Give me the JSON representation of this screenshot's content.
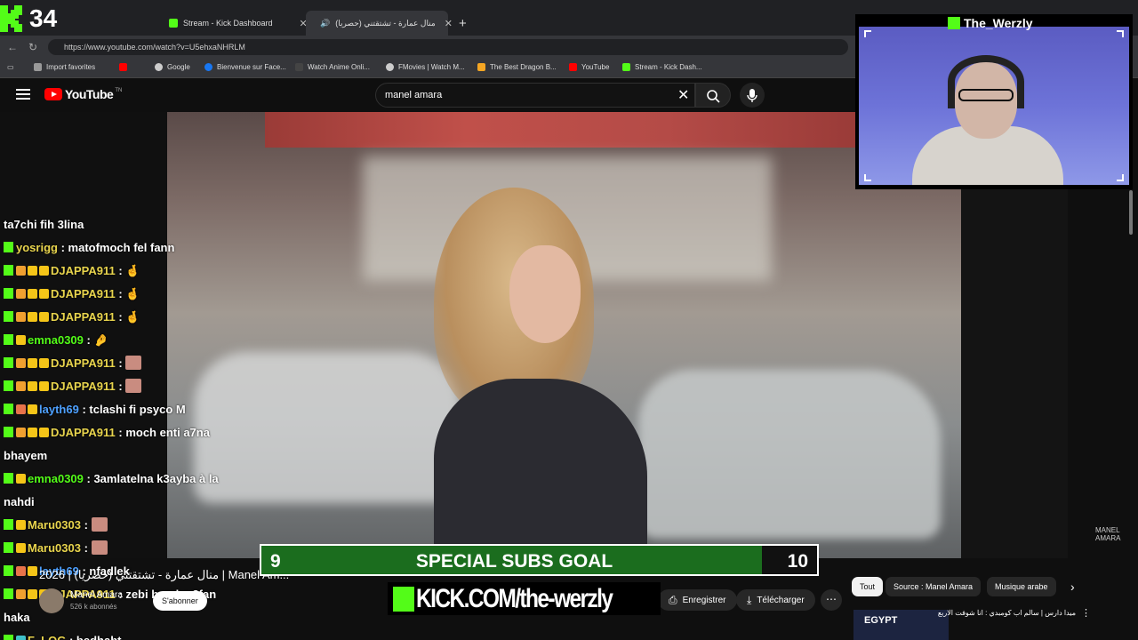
{
  "overlay": {
    "viewer_count": "34",
    "goal": {
      "current": "9",
      "title": "SPECIAL SUBS GOAL",
      "target": "10",
      "progress": 0.9
    },
    "kick_link": "KICK.COM/the-werzly",
    "streamer_name": "The_Werzly"
  },
  "browser": {
    "tabs": [
      {
        "label": "Stream - Kick Dashboard",
        "color": "#53fc18"
      },
      {
        "label": "منال عمارة - تشتقتني (حصريا)",
        "color": "#ff0000"
      }
    ],
    "url": "https://www.youtube.com/watch?v=U5ehxaNHRLM",
    "bookmarks": [
      {
        "label": "Import favorites",
        "color": "#999999"
      },
      {
        "label": "",
        "color": "#ff0000"
      },
      {
        "label": "Google",
        "color": "#cccccc"
      },
      {
        "label": "Bienvenue sur Face...",
        "color": "#1877f2"
      },
      {
        "label": "Watch Anime Onli...",
        "color": "#444444"
      },
      {
        "label": "FMovies | Watch M...",
        "color": "#cccccc"
      },
      {
        "label": "The Best Dragon B...",
        "color": "#f5a623"
      },
      {
        "label": "YouTube",
        "color": "#ff0000"
      },
      {
        "label": "Stream - Kick Dash...",
        "color": "#53fc18"
      }
    ]
  },
  "youtube": {
    "logo_text": "YouTube",
    "logo_tm": "TN",
    "search_value": "manel amara",
    "video_watermark": "MANEL AMARA",
    "video_title": "2026 | منال عمارة - تشتقتني (حصريا) | Manel Am...",
    "channel": {
      "name": "Manel Amara",
      "subs": "526 k abonnés"
    },
    "subscribe_label": "S'abonner",
    "actions": {
      "save": "Enregistrer",
      "download": "Télécharger"
    },
    "chips": [
      "Tout",
      "Source : Manel Amara",
      "Musique arabe"
    ],
    "recommendation": {
      "thumb_text": "EGYPT",
      "title": "ميدا دارس | سالم اب كومبدي : انا شوفت الاربع"
    }
  },
  "chat": [
    {
      "user": "",
      "text": "ta7chi fih 3lina",
      "name_color": "#ffffff",
      "badges": []
    },
    {
      "user": "yosrigg",
      "text": ": matofmoch fel fann",
      "name_color": "#e8d44d",
      "badges": [
        "k"
      ]
    },
    {
      "user": "DJAPPA911",
      "text": ": 🤞",
      "name_color": "#e8d44d",
      "badges": [
        "k",
        "hand",
        "coin",
        "crown"
      ]
    },
    {
      "user": "DJAPPA911",
      "text": ": 🤞",
      "name_color": "#e8d44d",
      "badges": [
        "k",
        "hand",
        "coin",
        "crown"
      ]
    },
    {
      "user": "DJAPPA911",
      "text": ": 🤞",
      "name_color": "#e8d44d",
      "badges": [
        "k",
        "hand",
        "coin",
        "crown"
      ]
    },
    {
      "user": "emna0309",
      "text": ": 🤌",
      "name_color": "#53fc18",
      "badges": [
        "k",
        "crown"
      ]
    },
    {
      "user": "DJAPPA911",
      "text": ":",
      "name_color": "#e8d44d",
      "badges": [
        "k",
        "hand",
        "coin",
        "crown"
      ],
      "emote": true
    },
    {
      "user": "DJAPPA911",
      "text": ":",
      "name_color": "#e8d44d",
      "badges": [
        "k",
        "hand",
        "coin",
        "crown"
      ],
      "emote": true
    },
    {
      "user": "layth69",
      "text": ": tclashi fi psyco M",
      "name_color": "#4ea1ff",
      "badges": [
        "k",
        "fire",
        "crown"
      ]
    },
    {
      "user": "DJAPPA911",
      "text": ": moch enti a7na",
      "name_color": "#e8d44d",
      "badges": [
        "k",
        "hand",
        "coin",
        "crown"
      ]
    },
    {
      "user": "",
      "text": "bhayem",
      "name_color": "#ffffff",
      "badges": []
    },
    {
      "user": "emna0309",
      "text": ": 3amlatelna k3ayba à la",
      "name_color": "#53fc18",
      "badges": [
        "k",
        "crown"
      ]
    },
    {
      "user": "",
      "text": "nahdi",
      "name_color": "#ffffff",
      "badges": []
    },
    {
      "user": "Maru0303",
      "text": ":",
      "name_color": "#e8d44d",
      "badges": [
        "k",
        "crown"
      ],
      "emote": true
    },
    {
      "user": "Maru0303",
      "text": ":",
      "name_color": "#e8d44d",
      "badges": [
        "k",
        "crown"
      ],
      "emote": true
    },
    {
      "user": "layth69",
      "text": ": nfadlek",
      "name_color": "#4ea1ff",
      "badges": [
        "k",
        "fire",
        "crown"
      ]
    },
    {
      "user": "DJAPPA911",
      "text": ": zebi barcha 3fan",
      "name_color": "#e8d44d",
      "badges": [
        "k",
        "hand",
        "coin",
        "crown"
      ]
    },
    {
      "user": "",
      "text": "haka",
      "name_color": "#ffffff",
      "badges": []
    },
    {
      "user": "F_LOG",
      "text": ": bedhabt",
      "name_color": "#e8d44d",
      "badges": [
        "k",
        "gp"
      ]
    }
  ],
  "colors": {
    "kick_green": "#53fc18",
    "goal_green": "#1b6d1e",
    "yt_red": "#ff0000"
  }
}
